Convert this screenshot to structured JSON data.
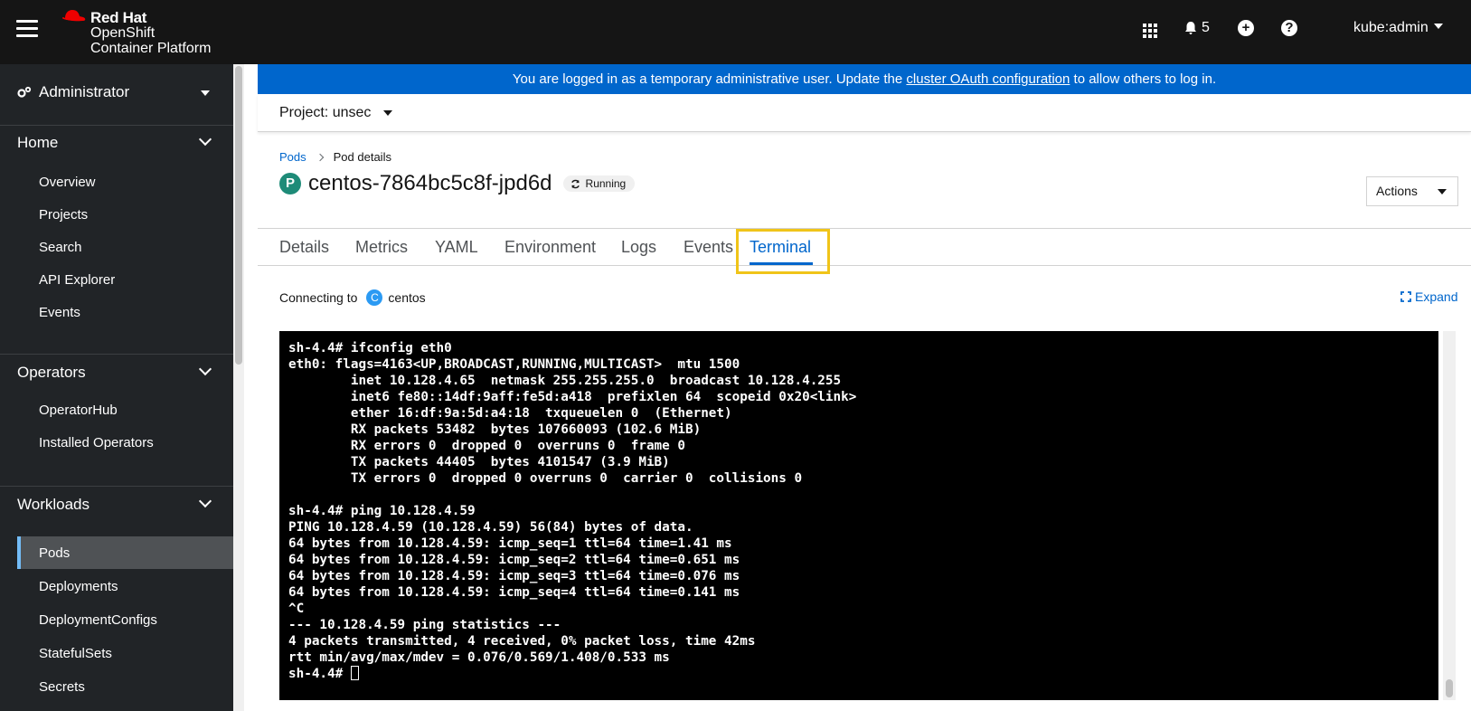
{
  "masthead": {
    "brand_line1": "Red Hat",
    "brand_line2": "OpenShift",
    "brand_line3": "Container Platform",
    "notification_count": "5",
    "user": "kube:admin"
  },
  "sidebar": {
    "perspective": "Administrator",
    "sections": [
      {
        "label": "Home",
        "items": [
          "Overview",
          "Projects",
          "Search",
          "API Explorer",
          "Events"
        ]
      },
      {
        "label": "Operators",
        "items": [
          "OperatorHub",
          "Installed Operators"
        ]
      },
      {
        "label": "Workloads",
        "items": [
          "Pods",
          "Deployments",
          "DeploymentConfigs",
          "StatefulSets",
          "Secrets"
        ]
      }
    ],
    "active_item": "Pods"
  },
  "banner": {
    "text_before": "You are logged in as a temporary administrative user. Update the ",
    "link": "cluster OAuth configuration",
    "text_after": " to allow others to log in."
  },
  "project": {
    "label": "Project: unsec"
  },
  "breadcrumb": {
    "parent": "Pods",
    "current": "Pod details"
  },
  "pod": {
    "badge": "P",
    "name": "centos-7864bc5c8f-jpd6d",
    "status": "Running"
  },
  "actions_label": "Actions",
  "tabs": [
    "Details",
    "Metrics",
    "YAML",
    "Environment",
    "Logs",
    "Events",
    "Terminal"
  ],
  "active_tab": "Terminal",
  "terminal_header": {
    "connecting_label": "Connecting to",
    "container_badge": "C",
    "container": "centos",
    "expand_label": "Expand"
  },
  "terminal_lines": [
    "sh-4.4# ifconfig eth0",
    "eth0: flags=4163<UP,BROADCAST,RUNNING,MULTICAST>  mtu 1500",
    "        inet 10.128.4.65  netmask 255.255.255.0  broadcast 10.128.4.255",
    "        inet6 fe80::14df:9aff:fe5d:a418  prefixlen 64  scopeid 0x20<link>",
    "        ether 16:df:9a:5d:a4:18  txqueuelen 0  (Ethernet)",
    "        RX packets 53482  bytes 107660093 (102.6 MiB)",
    "        RX errors 0  dropped 0  overruns 0  frame 0",
    "        TX packets 44405  bytes 4101547 (3.9 MiB)",
    "        TX errors 0  dropped 0 overruns 0  carrier 0  collisions 0",
    "",
    "sh-4.4# ping 10.128.4.59",
    "PING 10.128.4.59 (10.128.4.59) 56(84) bytes of data.",
    "64 bytes from 10.128.4.59: icmp_seq=1 ttl=64 time=1.41 ms",
    "64 bytes from 10.128.4.59: icmp_seq=2 ttl=64 time=0.651 ms",
    "64 bytes from 10.128.4.59: icmp_seq=3 ttl=64 time=0.076 ms",
    "64 bytes from 10.128.4.59: icmp_seq=4 ttl=64 time=0.141 ms",
    "^C",
    "--- 10.128.4.59 ping statistics ---",
    "4 packets transmitted, 4 received, 0% packet loss, time 42ms",
    "rtt min/avg/max/mdev = 0.076/0.569/1.408/0.533 ms",
    "sh-4.4# "
  ],
  "colors": {
    "masthead": "#151515",
    "sidebar": "#212427",
    "banner": "#0066cc",
    "link": "#0066cc",
    "highlight": "#f0c419",
    "pod_badge": "#1e8b78"
  }
}
